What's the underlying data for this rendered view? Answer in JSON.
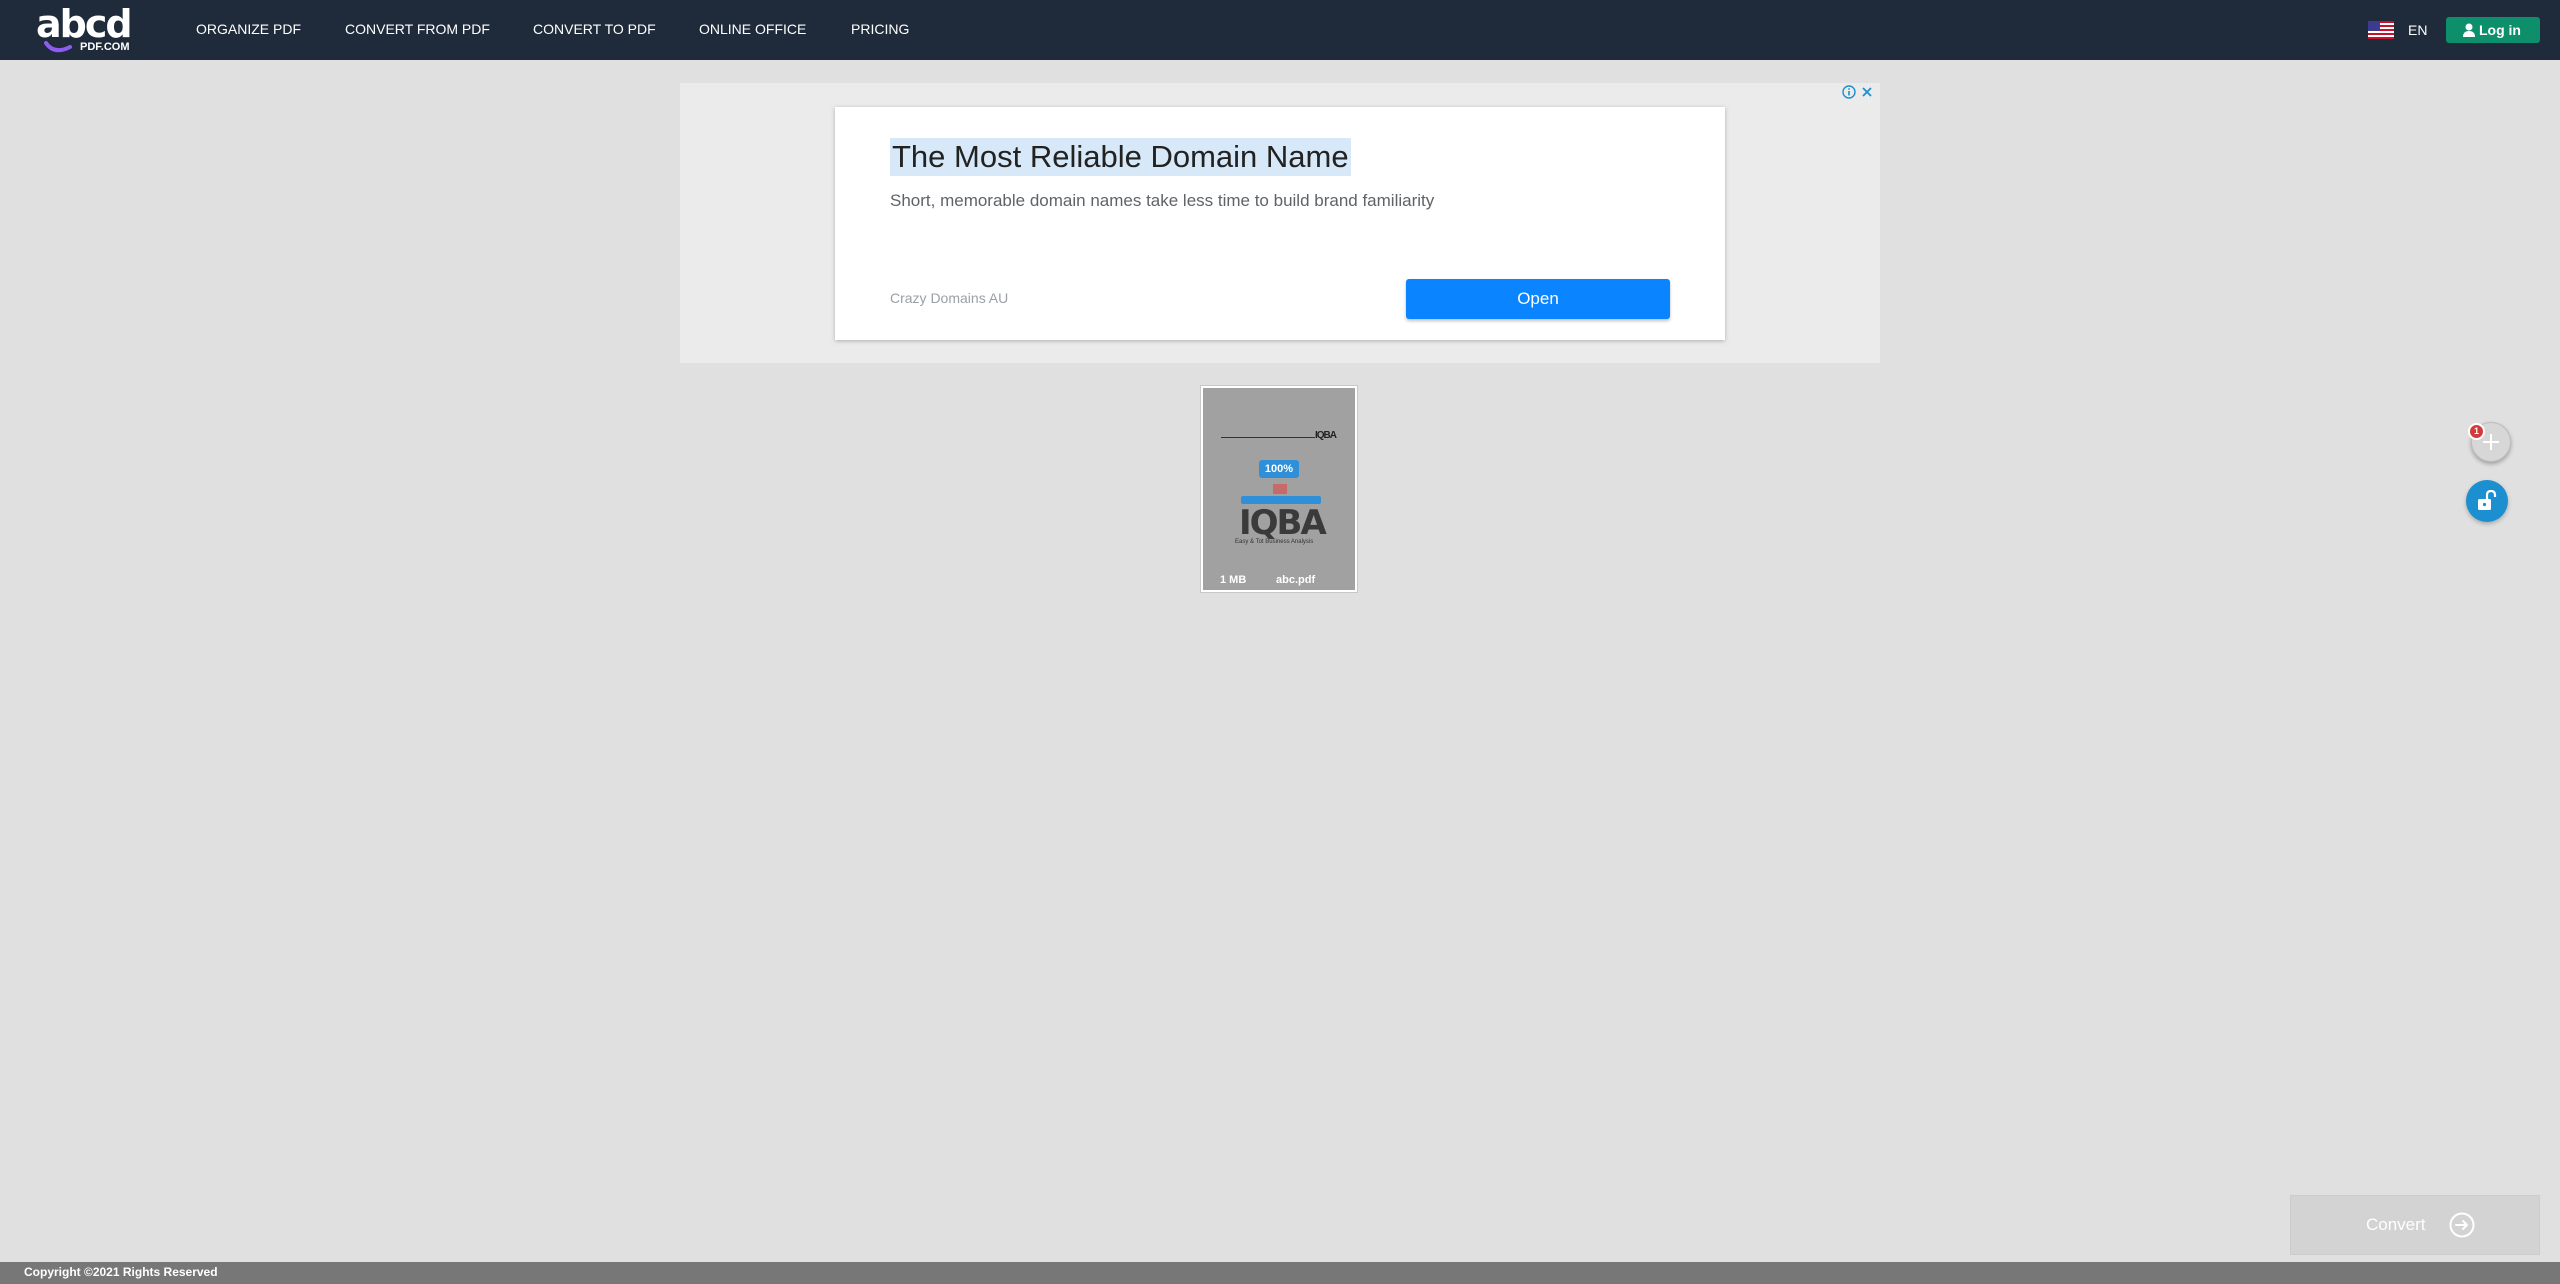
{
  "brand": {
    "logo_text": "abcd",
    "logo_sub": "PDF.COM"
  },
  "nav": {
    "items": [
      {
        "label": "ORGANIZE PDF"
      },
      {
        "label": "CONVERT FROM PDF"
      },
      {
        "label": "CONVERT TO PDF"
      },
      {
        "label": "ONLINE OFFICE"
      },
      {
        "label": "PRICING"
      }
    ],
    "language": "EN",
    "language_flag": "us-flag-icon",
    "login_label": "Log in"
  },
  "ad": {
    "title": "The Most Reliable Domain Name",
    "description": "Short, memorable domain names take less time to build brand familiarity",
    "advertiser": "Crazy Domains AU",
    "button_label": "Open",
    "choices_icon": "info-icon",
    "close_icon": "close-icon"
  },
  "file": {
    "size": "1 MB",
    "name": "abc.pdf",
    "progress": "100%",
    "thumbnail_logo": "IQBA",
    "thumbnail_caption": "Easy & Tot Business Analysis"
  },
  "actions": {
    "file_count": "1",
    "add_icon": "plus-icon",
    "unlock_icon": "unlock-icon"
  },
  "convert": {
    "label": "Convert",
    "icon": "arrow-right-circle-icon"
  },
  "footer": {
    "copyright": "Copyright ©2021 Rights Reserved"
  },
  "colors": {
    "navbar": "#1f2a3a",
    "login": "#0e8f6b",
    "ad_button": "#0a84ff",
    "background": "#e0e0e0",
    "accent_blue": "#1b8fcf",
    "badge_red": "#d43a3a"
  }
}
